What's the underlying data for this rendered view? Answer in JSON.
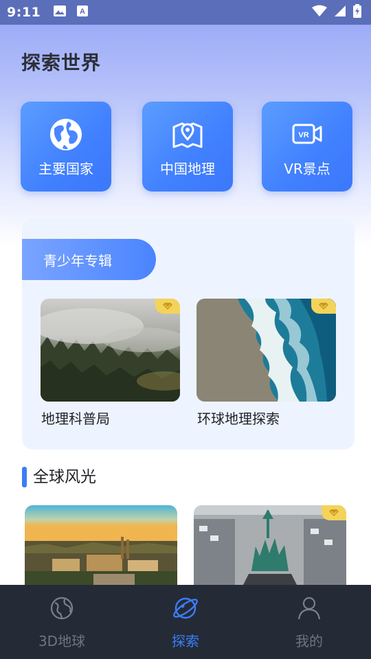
{
  "status_bar": {
    "time": "9:11",
    "icons": [
      "image-icon",
      "a-text-icon",
      "wifi-icon",
      "cellular-icon",
      "battery-charging-icon"
    ]
  },
  "page": {
    "title": "探索世界"
  },
  "categories": [
    {
      "label": "主要国家",
      "icon": "globe-icon"
    },
    {
      "label": "中国地理",
      "icon": "map-pin-icon"
    },
    {
      "label": "VR景点",
      "icon": "vr-camera-icon"
    }
  ],
  "youth_section": {
    "title": "青少年专辑",
    "items": [
      {
        "caption": "地理科普局",
        "badge": "vip-diamond-icon"
      },
      {
        "caption": "环球地理探索",
        "badge": "vip-diamond-icon"
      }
    ]
  },
  "scenery_section": {
    "title": "全球风光",
    "items": [
      {
        "image": "city-aerial-sunset",
        "badge": ""
      },
      {
        "image": "statue-snowy-city",
        "badge": "vip-diamond-icon"
      }
    ]
  },
  "bottom_nav": {
    "items": [
      {
        "label": "3D地球",
        "icon": "earth-3d-icon",
        "active": false
      },
      {
        "label": "探索",
        "icon": "compass-planet-icon",
        "active": true
      },
      {
        "label": "我的",
        "icon": "user-icon",
        "active": false
      }
    ]
  },
  "colors": {
    "accent": "#3d7cf7",
    "nav_bg": "#242b37",
    "vip_gold": "#f4d35b"
  }
}
